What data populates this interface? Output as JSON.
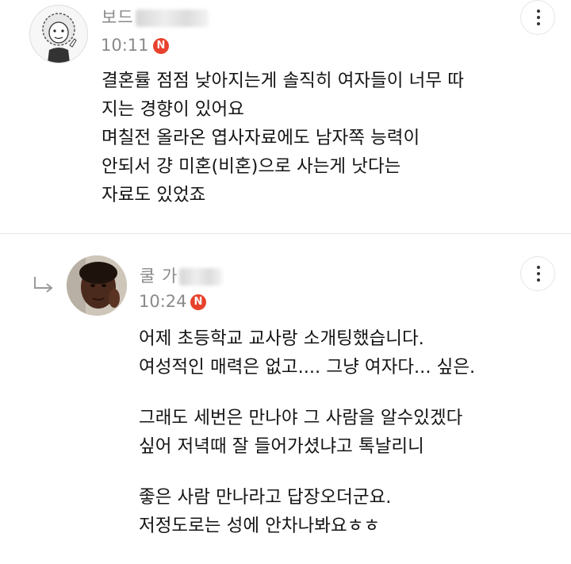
{
  "comments": [
    {
      "username_visible": "보드",
      "time": "10:11",
      "badge": "N",
      "lines": [
        "결혼률 점점 낮아지는게 솔직히 여자들이 너무 따",
        "지는 경향이 있어요",
        "며칠전 올라온 엽사자료에도 남자쪽 능력이",
        "안되서 걍 미혼(비혼)으로 사는게 낫다는",
        "자료도 있었죠"
      ]
    },
    {
      "username_visible": "쿨 가",
      "time": "10:24",
      "badge": "N",
      "lines": [
        "어제 초등학교 교사랑 소개팅했습니다.",
        "여성적인 매력은 없고.... 그냥 여자다... 싶은.",
        "",
        "그래도 세번은 만나야 그 사람을 알수있겠다",
        "싶어 저녁때 잘 들어가셨냐고 톡날리니",
        "",
        "좋은 사람 만나라고 답장오더군요.",
        "저정도로는 성에 안차나봐요ㅎㅎ"
      ]
    }
  ],
  "colors": {
    "badge": "#e8412c",
    "meta_text": "#8a8a8a",
    "divider": "#e6e6e6"
  },
  "icons": [
    "cartoon-avatar",
    "photo-avatar",
    "more-vertical-icon",
    "reply-arrow-icon",
    "new-badge-icon"
  ]
}
